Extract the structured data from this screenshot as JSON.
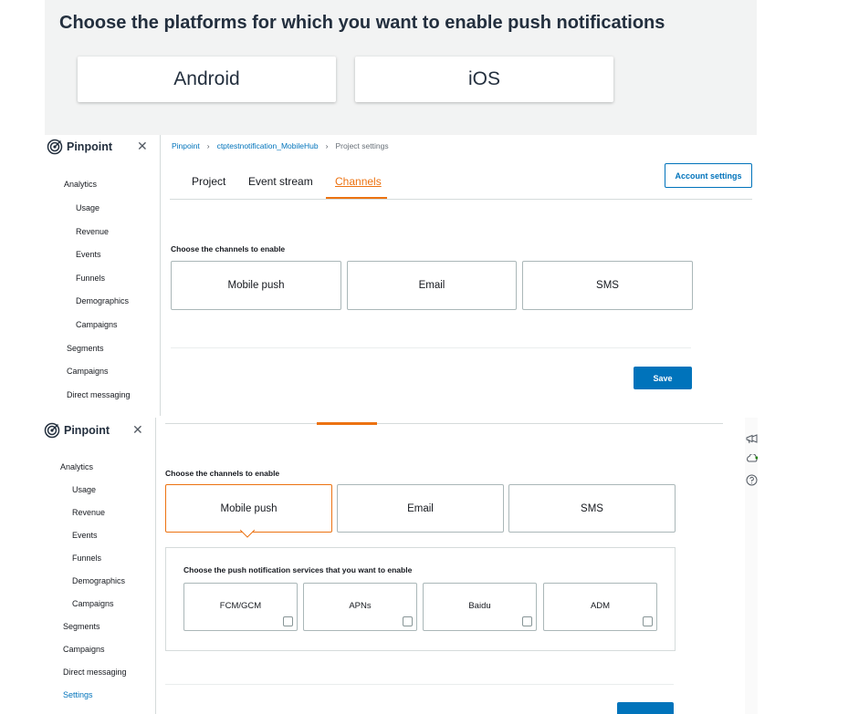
{
  "top": {
    "heading": "Choose the platforms for which you want to enable push notifications",
    "platforms": [
      "Android",
      "iOS"
    ]
  },
  "app": {
    "name": "Pinpoint",
    "close_glyph": "✕"
  },
  "nav": {
    "analytics": "Analytics",
    "analytics_items": [
      "Usage",
      "Revenue",
      "Events",
      "Funnels",
      "Demographics",
      "Campaigns"
    ],
    "segments": "Segments",
    "campaigns": "Campaigns",
    "direct_messaging": "Direct messaging",
    "settings": "Settings"
  },
  "breadcrumb": {
    "items": [
      "Pinpoint",
      "ctptestnotification_MobileHub",
      "Project settings"
    ],
    "separator": "›"
  },
  "tabs": [
    "Project",
    "Event stream",
    "Channels"
  ],
  "active_tab": "Channels",
  "account_settings_label": "Account settings",
  "channels": {
    "label": "Choose the channels to enable",
    "options": [
      "Mobile push",
      "Email",
      "SMS"
    ],
    "selected_bottom": "Mobile push"
  },
  "push_services": {
    "label": "Choose the push notification services that you want to enable",
    "options": [
      "FCM/GCM",
      "APNs",
      "Baidu",
      "ADM"
    ]
  },
  "save_label": "Save",
  "icons": {
    "pinpoint_logo": "target-icon",
    "right_rail": [
      "megaphone-icon",
      "cloud-refresh-icon",
      "help-icon"
    ]
  },
  "colors": {
    "accent": "#ec7211",
    "link": "#0073bb",
    "primary_button": "#0073bb",
    "border": "#aab7b8"
  }
}
